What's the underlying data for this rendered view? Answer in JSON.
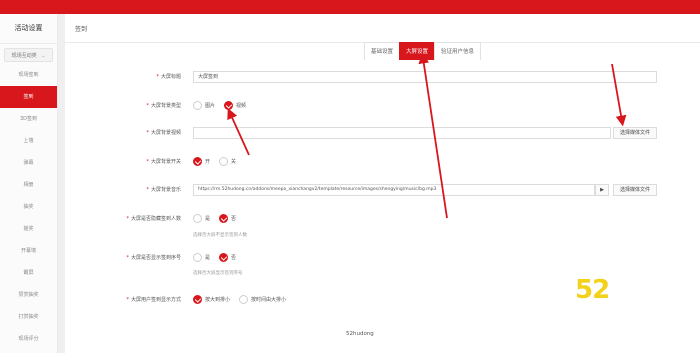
{
  "sidebar": {
    "title": "活动设置",
    "group_label": "现场互动类",
    "items": [
      {
        "label": "现场签到",
        "active": false
      },
      {
        "label": "签到",
        "active": true
      },
      {
        "label": "3D签到",
        "active": false
      },
      {
        "label": "上墙",
        "active": false
      },
      {
        "label": "弹幕",
        "active": false
      },
      {
        "label": "相册",
        "active": false
      },
      {
        "label": "抽奖",
        "active": false
      },
      {
        "label": "摇奖",
        "active": false
      },
      {
        "label": "开幕墙",
        "active": false
      },
      {
        "label": "霸屏",
        "active": false
      },
      {
        "label": "赞赏抽奖",
        "active": false
      },
      {
        "label": "打赏抽奖",
        "active": false
      },
      {
        "label": "现场评分",
        "active": false
      }
    ]
  },
  "header": {
    "breadcrumb": "签到"
  },
  "tabs": [
    {
      "label": "基础设置",
      "active": false
    },
    {
      "label": "大屏设置",
      "active": true
    },
    {
      "label": "验证用户信息",
      "active": false
    }
  ],
  "form": {
    "title": {
      "label": "大屏标题",
      "value": "大屏签到"
    },
    "bg_type": {
      "label": "大屏背景类型",
      "options": [
        "图片",
        "视频"
      ],
      "selected": 1
    },
    "bg_video": {
      "label": "大屏背景视频",
      "value": "",
      "button": "选择媒体文件"
    },
    "bg_music_switch": {
      "label": "大屏背景开关",
      "options": [
        "开",
        "关"
      ],
      "selected": 0
    },
    "bg_music": {
      "label": "大屏背景音乐",
      "value": "https://rm.52hudong.cn/addons/meepo_xianchangv2/template/resource/images/shengying/music/bg.mp3",
      "play": "▶",
      "button": "选择媒体文件"
    },
    "show_count": {
      "label": "大屏是否隐藏签到人数",
      "options": [
        "是",
        "否"
      ],
      "selected": 1,
      "hint": "选择否大屏不显示签到人数"
    },
    "show_number": {
      "label": "大屏是否显示签到序号",
      "options": [
        "是",
        "否"
      ],
      "selected": 1,
      "hint": "选择否大屏显示签到序号"
    },
    "sort": {
      "label": "大屏用户签到显示方式",
      "options": [
        "按大到排小",
        "按时间由大排小"
      ],
      "selected": 0
    }
  },
  "watermark": "52",
  "footer": "52hudong",
  "colors": {
    "brand": "#d7171c",
    "watermark": "#f2d21a"
  }
}
